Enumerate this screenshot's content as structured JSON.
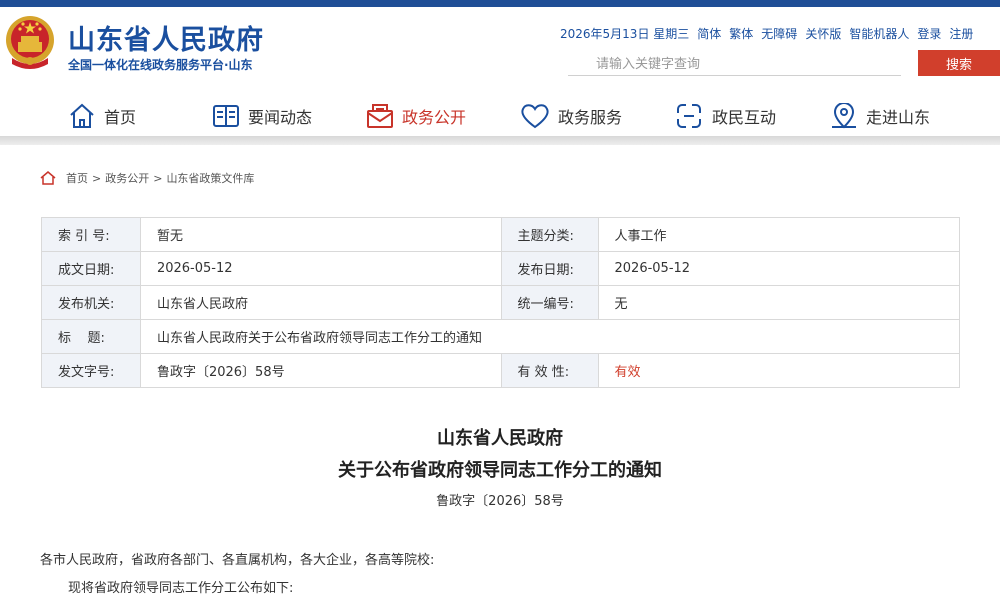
{
  "header": {
    "site_title": "山东省人民政府",
    "site_subtitle": "全国一体化在线政务服务平台·山东",
    "top_links": {
      "date": "2026年5月13日 星期三",
      "simplified": "简体",
      "traditional": "繁体",
      "accessible": "无障碍",
      "elderly": "关怀版",
      "robot": "智能机器人",
      "login": "登录",
      "register": "注册"
    },
    "search": {
      "placeholder": "请输入关键字查询",
      "button_label": "搜索"
    }
  },
  "nav": {
    "items": [
      {
        "label": "首页",
        "icon": "home-icon"
      },
      {
        "label": "要闻动态",
        "icon": "book-icon"
      },
      {
        "label": "政务公开",
        "icon": "mail-icon",
        "active": true
      },
      {
        "label": "政务服务",
        "icon": "heart-icon"
      },
      {
        "label": "政民互动",
        "icon": "interaction-icon"
      },
      {
        "label": "走进山东",
        "icon": "location-icon"
      }
    ],
    "active_color": "#c8342a"
  },
  "breadcrumb": {
    "items": [
      "首页",
      "政务公开",
      "山东省政策文件库"
    ],
    "separator": ">"
  },
  "info": {
    "index_label": "索 引 号:",
    "index_value": "暂无",
    "topic_label": "主题分类:",
    "topic_value": "人事工作",
    "created_label": "成文日期:",
    "created_value": "2026-05-12",
    "published_label": "发布日期:",
    "published_value": "2026-05-12",
    "issuer_label": "发布机关:",
    "issuer_value": "山东省人民政府",
    "uniform_label": "统一编号:",
    "uniform_value": "无",
    "title_label": "标    题:",
    "title_value": "山东省人民政府关于公布省政府领导同志工作分工的通知",
    "docno_label": "发文字号:",
    "docno_value": "鲁政字〔2026〕58号",
    "validity_label": "有 效 性:",
    "validity_value": "有效"
  },
  "document": {
    "title_line1": "山东省人民政府",
    "title_line2": "关于公布省政府领导同志工作分工的通知",
    "number": "鲁政字〔2026〕58号",
    "addressee": "各市人民政府，省政府各部门、各直属机构，各大企业，各高等院校:",
    "paragraph1": "现将省政府领导同志工作分工公布如下:"
  },
  "colors": {
    "brand_blue": "#1a4f9f",
    "search_red": "#d13f2c",
    "table_label_bg": "#f0f3f8"
  }
}
